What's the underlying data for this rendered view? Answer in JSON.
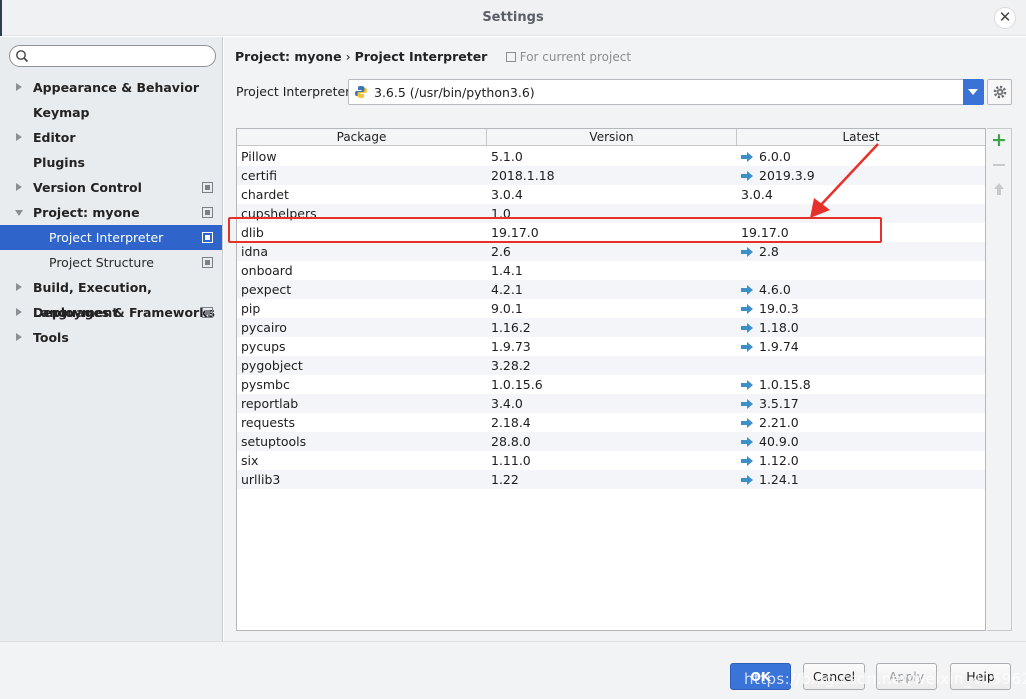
{
  "window": {
    "title": "Settings",
    "close_glyph": "✕"
  },
  "search": {
    "placeholder": ""
  },
  "sidebar": {
    "items": [
      {
        "label": "Appearance & Behavior",
        "expandable": true
      },
      {
        "label": "Keymap",
        "expandable": false
      },
      {
        "label": "Editor",
        "expandable": true
      },
      {
        "label": "Plugins",
        "expandable": false
      },
      {
        "label": "Version Control",
        "expandable": true
      },
      {
        "label": "Project: myone",
        "expandable": true,
        "expanded": true
      },
      {
        "label": "Project Interpreter",
        "sub": true,
        "selected": true
      },
      {
        "label": "Project Structure",
        "sub": true
      },
      {
        "label": "Build, Execution, Deployment",
        "expandable": true
      },
      {
        "label": "Languages & Frameworks",
        "expandable": true
      },
      {
        "label": "Tools",
        "expandable": true
      }
    ]
  },
  "breadcrumb": {
    "project": "Project: myone",
    "separator": "›",
    "page": "Project Interpreter",
    "scope": "For current project"
  },
  "interpreter": {
    "label": "Project Interpreter:",
    "value": "3.6.5 (/usr/bin/python3.6)"
  },
  "table": {
    "columns": [
      "Package",
      "Version",
      "Latest"
    ],
    "rows": [
      {
        "package": "Pillow",
        "version": "5.1.0",
        "latest": "6.0.0",
        "upgrade": true
      },
      {
        "package": "certifi",
        "version": "2018.1.18",
        "latest": "2019.3.9",
        "upgrade": true
      },
      {
        "package": "chardet",
        "version": "3.0.4",
        "latest": "3.0.4",
        "upgrade": false
      },
      {
        "package": "cupshelpers",
        "version": "1.0",
        "latest": "",
        "upgrade": false
      },
      {
        "package": "dlib",
        "version": "19.17.0",
        "latest": "19.17.0",
        "upgrade": false
      },
      {
        "package": "idna",
        "version": "2.6",
        "latest": "2.8",
        "upgrade": true
      },
      {
        "package": "onboard",
        "version": "1.4.1",
        "latest": "",
        "upgrade": false
      },
      {
        "package": "pexpect",
        "version": "4.2.1",
        "latest": "4.6.0",
        "upgrade": true
      },
      {
        "package": "pip",
        "version": "9.0.1",
        "latest": "19.0.3",
        "upgrade": true
      },
      {
        "package": "pycairo",
        "version": "1.16.2",
        "latest": "1.18.0",
        "upgrade": true
      },
      {
        "package": "pycups",
        "version": "1.9.73",
        "latest": "1.9.74",
        "upgrade": true
      },
      {
        "package": "pygobject",
        "version": "3.28.2",
        "latest": "",
        "upgrade": false
      },
      {
        "package": "pysmbc",
        "version": "1.0.15.6",
        "latest": "1.0.15.8",
        "upgrade": true
      },
      {
        "package": "reportlab",
        "version": "3.4.0",
        "latest": "3.5.17",
        "upgrade": true
      },
      {
        "package": "requests",
        "version": "2.18.4",
        "latest": "2.21.0",
        "upgrade": true
      },
      {
        "package": "setuptools",
        "version": "28.8.0",
        "latest": "40.9.0",
        "upgrade": true
      },
      {
        "package": "six",
        "version": "1.11.0",
        "latest": "1.12.0",
        "upgrade": true
      },
      {
        "package": "urllib3",
        "version": "1.22",
        "latest": "1.24.1",
        "upgrade": true
      }
    ]
  },
  "tools": {
    "add": "+"
  },
  "footer": {
    "ok": "OK",
    "cancel": "Cancel",
    "apply": "Apply",
    "help": "Help"
  },
  "watermark": "https://blog.csdn.net/weixin_41596280",
  "colors": {
    "selection": "#2f65ca",
    "annotation": "#e8302a",
    "upgrade_arrow": "#3d8fc8",
    "add": "#3ea34a"
  }
}
